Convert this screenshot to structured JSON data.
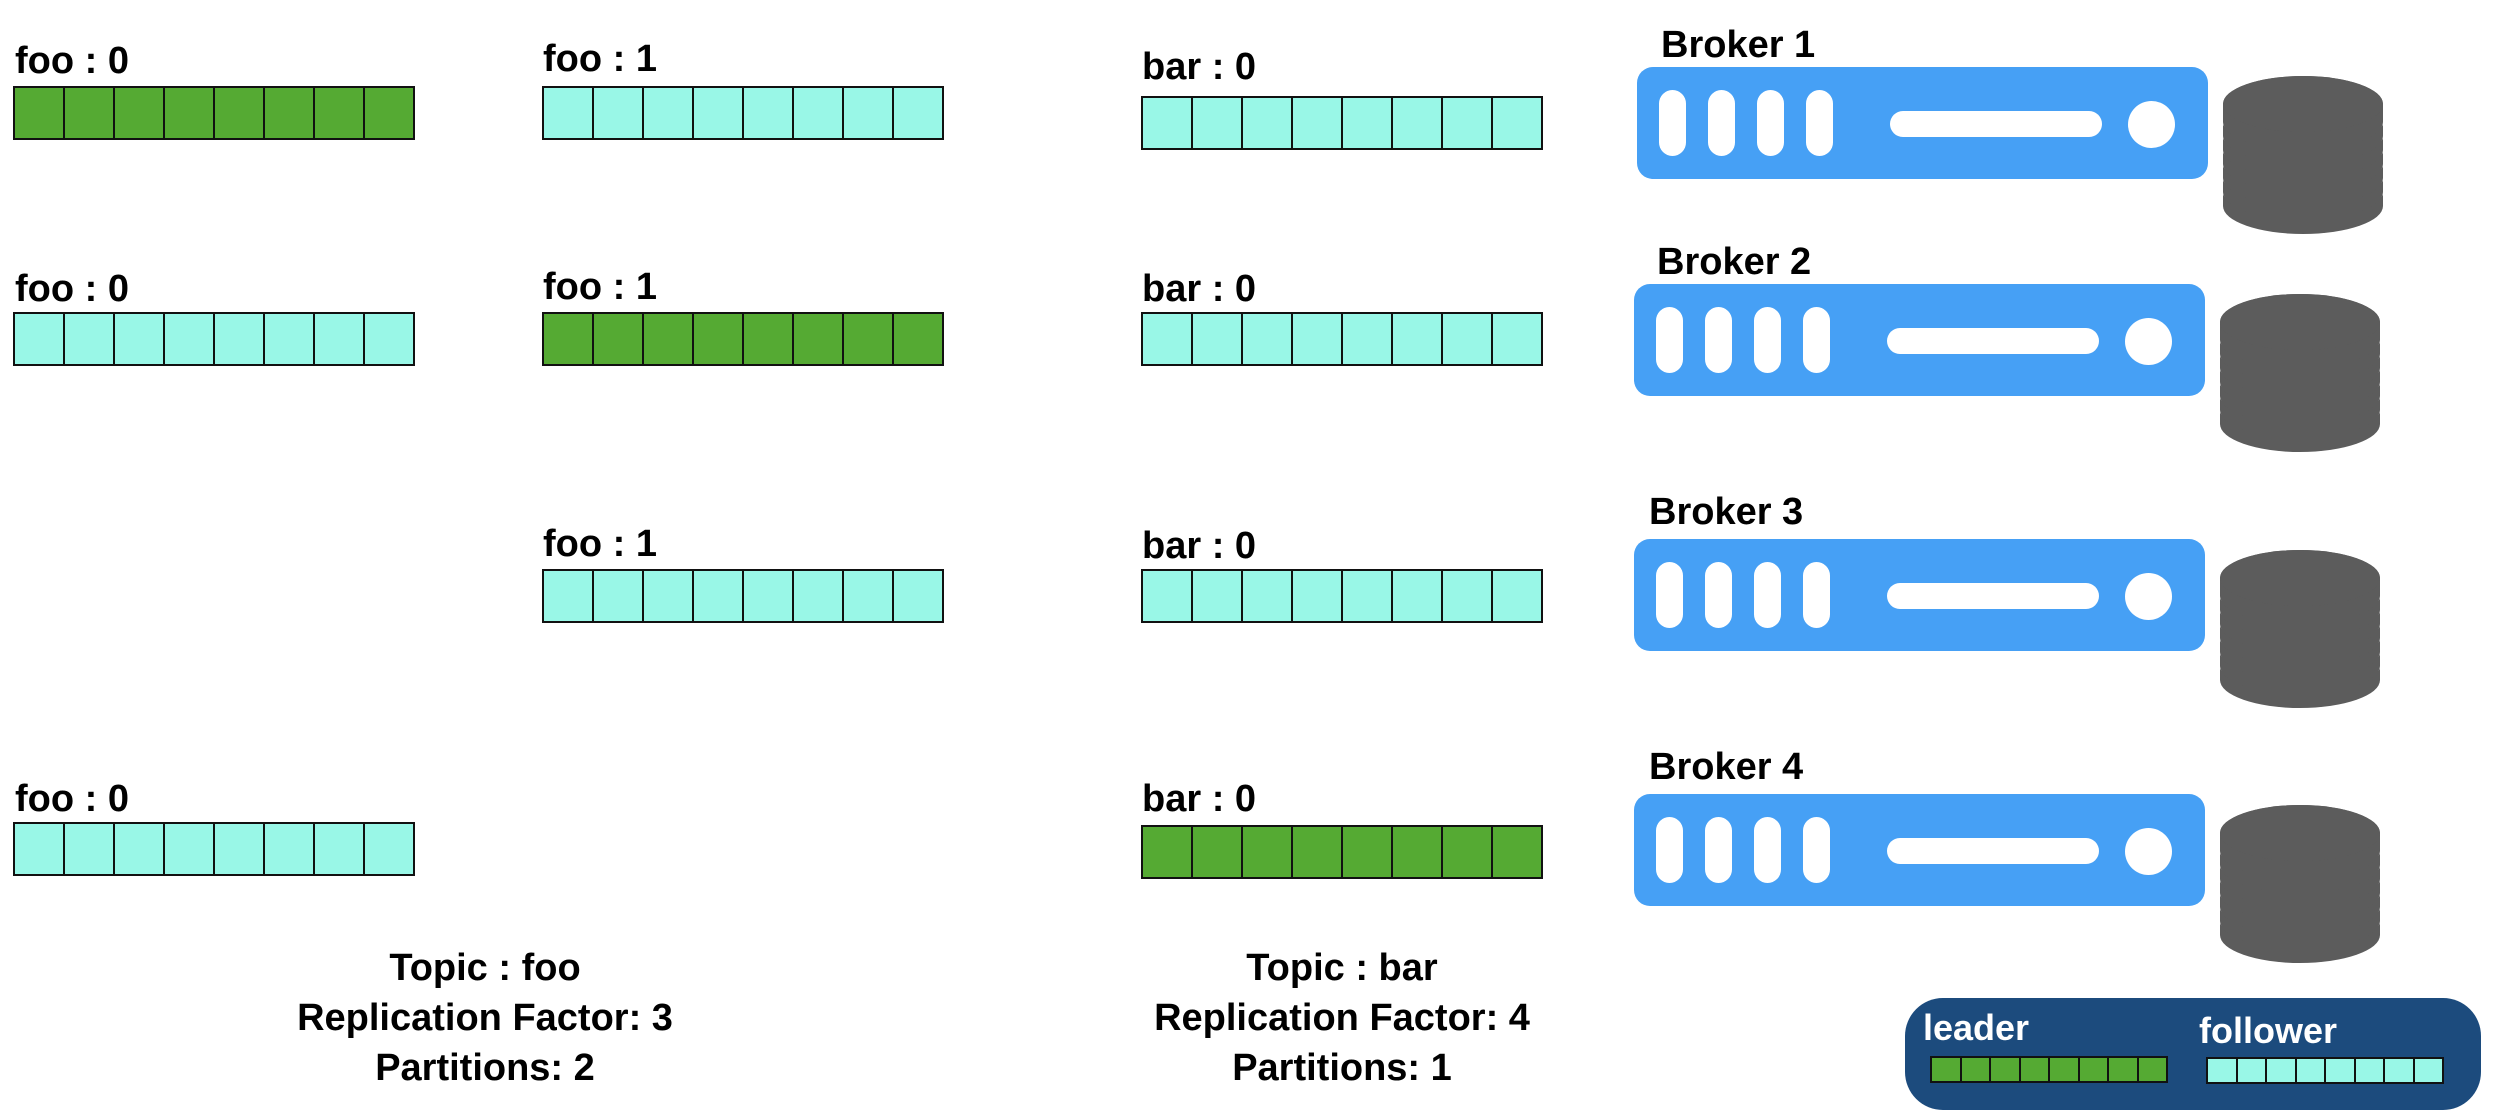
{
  "colors": {
    "leader": "#55aa33",
    "follower": "#99f7e7",
    "server": "#46a0f5",
    "disk": "#5c5c5c",
    "legend_bg": "#1c4b7d"
  },
  "brokers": [
    {
      "label": "Broker 1"
    },
    {
      "label": "Broker 2"
    },
    {
      "label": "Broker 3"
    },
    {
      "label": "Broker 4"
    }
  ],
  "replicas": {
    "foo0": [
      {
        "broker": 1,
        "label": "foo : 0",
        "role": "leader"
      },
      {
        "broker": 2,
        "label": "foo : 0",
        "role": "follower"
      },
      {
        "broker": 4,
        "label": "foo : 0",
        "role": "follower"
      }
    ],
    "foo1": [
      {
        "broker": 1,
        "label": "foo : 1",
        "role": "follower"
      },
      {
        "broker": 2,
        "label": "foo : 1",
        "role": "leader"
      },
      {
        "broker": 3,
        "label": "foo : 1",
        "role": "follower"
      }
    ],
    "bar0": [
      {
        "broker": 1,
        "label": "bar : 0",
        "role": "follower"
      },
      {
        "broker": 2,
        "label": "bar : 0",
        "role": "follower"
      },
      {
        "broker": 3,
        "label": "bar : 0",
        "role": "follower"
      },
      {
        "broker": 4,
        "label": "bar : 0",
        "role": "leader"
      }
    ]
  },
  "log_segments": 8,
  "topics": [
    {
      "title": "Topic : foo",
      "replication": "Replication Factor: 3",
      "partitions": "Partitions: 2"
    },
    {
      "title": "Topic : bar",
      "replication": "Replication Factor: 4",
      "partitions": "Partitions: 1"
    }
  ],
  "legend": {
    "leader_label": "leader",
    "follower_label": "follower"
  }
}
